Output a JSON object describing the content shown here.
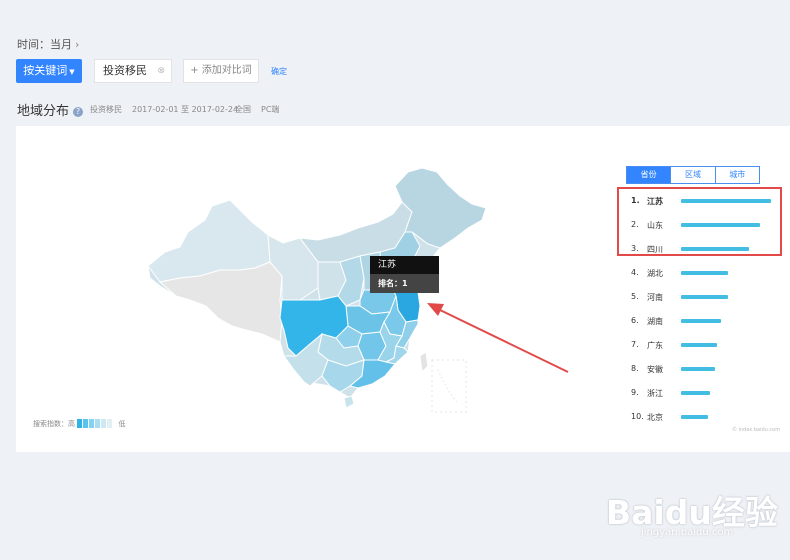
{
  "filters": {
    "time_label": "时间：当月",
    "keyword_button": "按关键词",
    "keyword_tag": "投资移民",
    "add_compare": "+ 添加对比词",
    "confirm": "确定"
  },
  "section": {
    "title": "地域分布",
    "keyword": "投资移民",
    "date_range": "2017-02-01 至 2017-02-24",
    "scope": "全国",
    "device": "PC端"
  },
  "tooltip": {
    "province": "江苏",
    "rank_label": "排名：1"
  },
  "legend": {
    "label_high": "搜索指数：高",
    "label_low": "低",
    "colors": [
      "#2fb3e6",
      "#58c3ec",
      "#82d3f1",
      "#a9ddf0",
      "#cde9f3",
      "#e4eff3"
    ]
  },
  "tabs": [
    {
      "label": "省份",
      "active": true
    },
    {
      "label": "区域",
      "active": false
    },
    {
      "label": "城市",
      "active": false
    }
  ],
  "ranking": [
    {
      "rank": "1.",
      "name": "江苏",
      "level": 1.0
    },
    {
      "rank": "2.",
      "name": "山东",
      "level": 0.88
    },
    {
      "rank": "3.",
      "name": "四川",
      "level": 0.76
    },
    {
      "rank": "4.",
      "name": "湖北",
      "level": 0.52
    },
    {
      "rank": "5.",
      "name": "河南",
      "level": 0.52
    },
    {
      "rank": "6.",
      "name": "湖南",
      "level": 0.44
    },
    {
      "rank": "7.",
      "name": "广东",
      "level": 0.4
    },
    {
      "rank": "8.",
      "name": "安徽",
      "level": 0.38
    },
    {
      "rank": "9.",
      "name": "浙江",
      "level": 0.32
    },
    {
      "rank": "10.",
      "name": "北京",
      "level": 0.3
    }
  ],
  "credit": "© index.baidu.com",
  "watermark": {
    "logo": "Baidu经验",
    "url": "jingyan.baidu.com"
  },
  "colors": {
    "accent": "#3385ff",
    "highlight_box": "#e24a4a",
    "bar": "#44bde3"
  }
}
